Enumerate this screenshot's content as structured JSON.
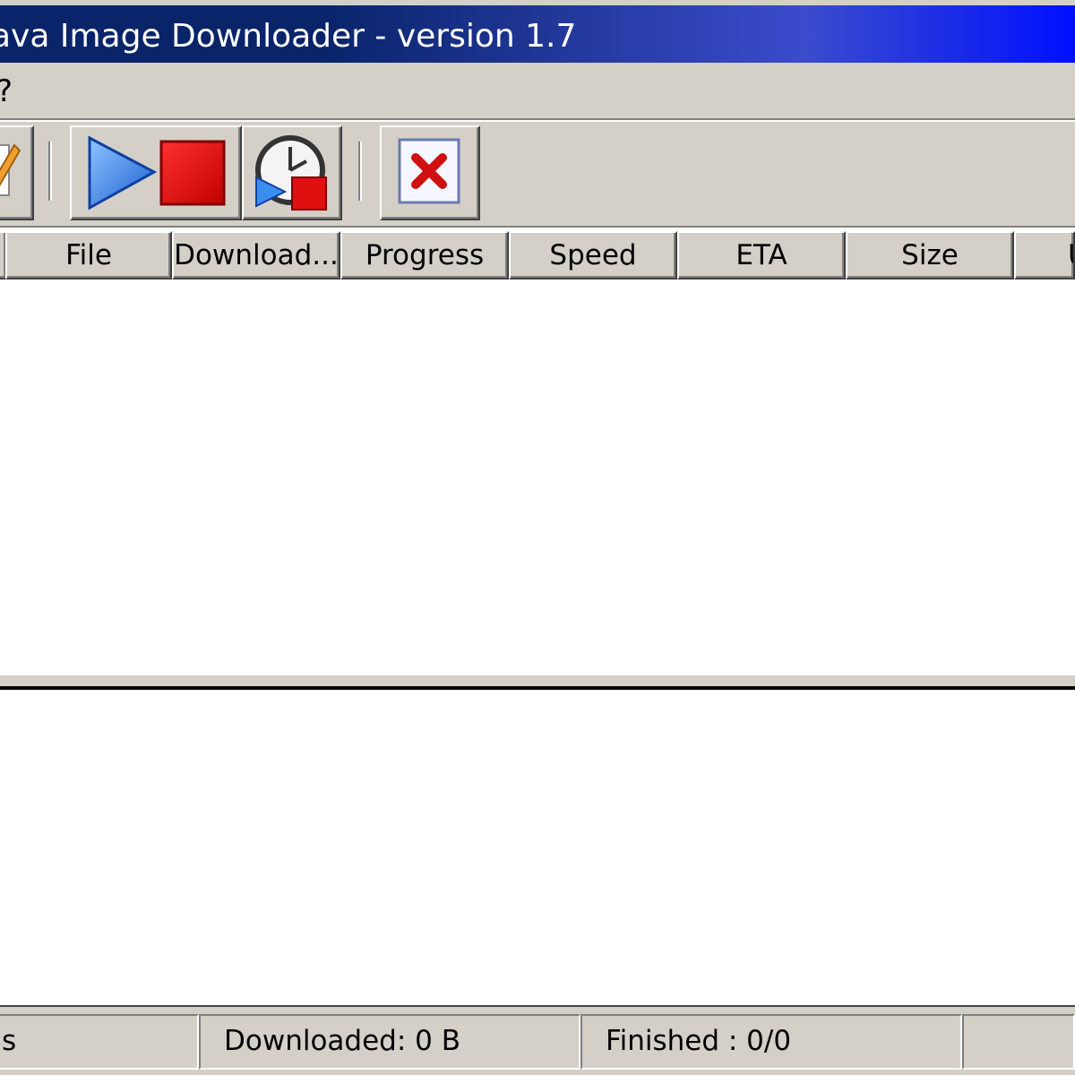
{
  "window": {
    "title": "ava Image Downloader - version 1.7"
  },
  "menu": {
    "items": [
      {
        "label": "?"
      }
    ]
  },
  "toolbar": {
    "buttons": [
      {
        "name": "edit",
        "icon": "edit-document-icon"
      },
      {
        "name": "start-stop",
        "icon": "play-stop-icon"
      },
      {
        "name": "scheduler",
        "icon": "clock-schedule-icon"
      },
      {
        "name": "delete",
        "icon": "delete-x-icon"
      }
    ]
  },
  "table": {
    "columns": [
      {
        "label": ""
      },
      {
        "label": "File"
      },
      {
        "label": "Download..."
      },
      {
        "label": "Progress"
      },
      {
        "label": "Speed"
      },
      {
        "label": "ETA"
      },
      {
        "label": "Size"
      },
      {
        "label": "U"
      }
    ],
    "rows": []
  },
  "status": {
    "cell0": "s",
    "downloaded": "Downloaded: 0 B",
    "finished": "Finished : 0/0",
    "cell3": ""
  },
  "colors": {
    "title_start": "#0a246a",
    "title_end": "#0010ff",
    "face": "#d4d0c8",
    "play_blue": "#2a7ee6",
    "stop_red": "#e01010"
  }
}
